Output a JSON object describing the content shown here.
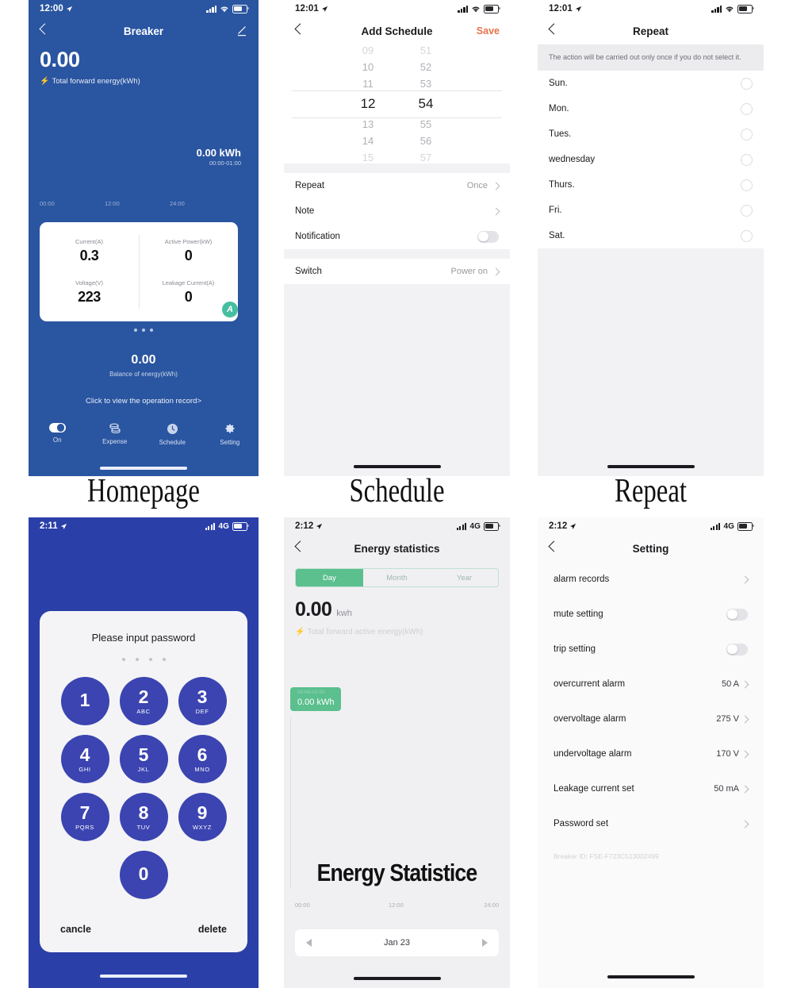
{
  "homepage": {
    "caption": "Homepage",
    "status": {
      "time": "12:00",
      "network": "",
      "location_icon": "location-arrow-icon"
    },
    "nav": {
      "back_icon": "back-chevron-icon",
      "title": "Breaker",
      "edit_icon": "pencil-edit-icon"
    },
    "hero": {
      "value": "0.00",
      "label": "Total forward energy(kWh)",
      "bolt_icon": "lightning-bolt-icon"
    },
    "chart_tooltip": {
      "value": "0.00 kWh",
      "range": "00:00-01:00"
    },
    "chart_axis": [
      "00:00",
      "12:00",
      "24:00"
    ],
    "metrics": [
      {
        "label": "Current(A)",
        "value": "0.3"
      },
      {
        "label": "Active Power(kW)",
        "value": "0"
      },
      {
        "label": "Voltage(V)",
        "value": "223"
      },
      {
        "label": "Leakage Current(A)",
        "value": "0"
      }
    ],
    "badge": "A",
    "balance": {
      "value": "0.00",
      "label": "Balance of energy(kWh)"
    },
    "record_link": "Click to view the operation record>",
    "tabs": [
      {
        "label": "On",
        "icon": "toggle-on-icon"
      },
      {
        "label": "Expense",
        "icon": "coins-stack-icon"
      },
      {
        "label": "Schedule",
        "icon": "clock-icon"
      },
      {
        "label": "Setting",
        "icon": "gear-icon"
      }
    ]
  },
  "schedule": {
    "caption": "Schedule",
    "status": {
      "time": "12:01"
    },
    "nav": {
      "title": "Add Schedule",
      "save_label": "Save"
    },
    "picker": {
      "hours": [
        "09",
        "10",
        "11",
        "12",
        "13",
        "14",
        "15"
      ],
      "minutes": [
        "51",
        "52",
        "53",
        "54",
        "55",
        "56",
        "57"
      ],
      "selected_hour": "12",
      "selected_minute": "54"
    },
    "rows": [
      {
        "label": "Repeat",
        "value": "Once",
        "chevron": true
      },
      {
        "label": "Note",
        "value": "",
        "chevron": true
      },
      {
        "label": "Notification",
        "value": "",
        "toggle": "off"
      }
    ],
    "switch_row": {
      "label": "Switch",
      "value": "Power on",
      "chevron": true
    }
  },
  "repeat": {
    "caption": "Repeat",
    "status": {
      "time": "12:01"
    },
    "nav": {
      "title": "Repeat"
    },
    "note": "The action will be carried out only once if you do not select it.",
    "days": [
      "Sun.",
      "Mon.",
      "Tues.",
      "wednesday",
      "Thurs.",
      "Fri.",
      "Sat."
    ]
  },
  "keypad": {
    "status": {
      "time": "2:11",
      "network": "4G"
    },
    "title": "Please input password",
    "dots": 4,
    "keys": [
      {
        "digit": "1",
        "letters": ""
      },
      {
        "digit": "2",
        "letters": "ABC"
      },
      {
        "digit": "3",
        "letters": "DEF"
      },
      {
        "digit": "4",
        "letters": "GHI"
      },
      {
        "digit": "5",
        "letters": "JKL"
      },
      {
        "digit": "6",
        "letters": "MNO"
      },
      {
        "digit": "7",
        "letters": "PQRS"
      },
      {
        "digit": "8",
        "letters": "TUV"
      },
      {
        "digit": "9",
        "letters": "WXYZ"
      },
      {
        "digit": "0",
        "letters": ""
      }
    ],
    "cancel_label": "cancle",
    "delete_label": "delete"
  },
  "energy": {
    "status": {
      "time": "2:12",
      "network": "4G"
    },
    "nav": {
      "title": "Energy statistics"
    },
    "segments": [
      "Day",
      "Month",
      "Year"
    ],
    "selected_segment": "Day",
    "total": {
      "value": "0.00",
      "unit": "kwh"
    },
    "total_label": "Total forward active energy(kWh)",
    "tooltip": {
      "range": "00:00-01:00",
      "value": "0.00 kWh"
    },
    "overlay_text": "Energy  Statistice",
    "axis": [
      "00:00",
      "12:00",
      "24:00"
    ],
    "date": "Jan 23",
    "prev_icon": "triangle-left-icon",
    "next_icon": "triangle-right-icon",
    "chart_data": {
      "type": "bar",
      "title": "Energy statistics",
      "categories": [
        "00:00",
        "12:00",
        "24:00"
      ],
      "values": [
        0,
        0,
        0
      ],
      "xlabel": "",
      "ylabel": "kWh",
      "ylim": [
        0,
        0
      ],
      "annotation": "0.00 kWh",
      "legend": "Total forward active energy(kWh)"
    }
  },
  "setting": {
    "status": {
      "time": "2:12",
      "network": "4G"
    },
    "nav": {
      "title": "Setting"
    },
    "rows": [
      {
        "label": "alarm records",
        "value": "",
        "type": "chevron"
      },
      {
        "label": "mute setting",
        "value": "",
        "type": "toggle"
      },
      {
        "label": "trip setting",
        "value": "",
        "type": "toggle"
      },
      {
        "label": "overcurrent alarm",
        "value": "50 A",
        "type": "chevron"
      },
      {
        "label": "overvoltage alarm",
        "value": "275 V",
        "type": "chevron"
      },
      {
        "label": "undervoltage alarm",
        "value": "170 V",
        "type": "chevron"
      },
      {
        "label": "Leakage current set",
        "value": "50 mA",
        "type": "chevron"
      },
      {
        "label": "Password set",
        "value": "",
        "type": "chevron"
      }
    ],
    "breaker_id": "Breaker ID: FSE-F723C513002499"
  },
  "colors": {
    "homepage_blue": "#2a55a0",
    "keypad_blue": "#2a3fa8",
    "key_button": "#3b44b0",
    "save_orange": "#e8734a",
    "green": "#5bbf8e",
    "badge_teal": "#46bfa0"
  }
}
